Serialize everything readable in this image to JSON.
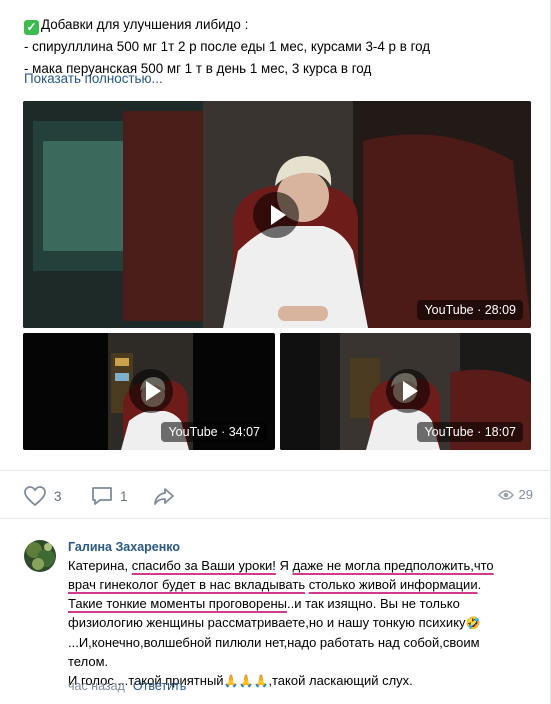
{
  "post": {
    "line1": "Добавки для улучшения либидо :",
    "line2": "- спирулллина 500 мг 1т 2 р после еды 1 мес, курсами 3-4 р в год",
    "line3": "- мака перуанская 500 мг 1 т в день 1 мес, 3 курса в год",
    "show_more": "Показать полностью..."
  },
  "videos": [
    {
      "source": "YouTube",
      "duration": "28:09",
      "badge": "YouTube · 28:09"
    },
    {
      "source": "YouTube",
      "duration": "34:07",
      "badge": "YouTube · 34:07"
    },
    {
      "source": "YouTube",
      "duration": "18:07",
      "badge": "YouTube · 18:07"
    }
  ],
  "actions": {
    "likes": "3",
    "comments": "1",
    "views": "29"
  },
  "comment": {
    "author": "Галина Захаренко",
    "lines": [
      {
        "a": "Катерина, ",
        "u1": "спасибо за Ваши уроки!",
        "b": " Я ",
        "u2": "даже не могла предположить,что"
      },
      {
        "u1": "врач гинеколог будет в нас вкладывать",
        "b": " ",
        "u2": "столько живой информации",
        "c": "."
      },
      {
        "u1": "Такие тонкие моменты проговорены",
        "b": "..и так изящно. Вы не только"
      },
      {
        "a": "физиологию женщины рассматриваете,но и нашу тонкую психику",
        "emoji": "🤣"
      },
      {
        "a": "...И,конечно,волшебной пилюли нет,надо работать над собой,своим"
      },
      {
        "a": "телом."
      },
      {
        "a": "И голос....такой приятный",
        "emoji": "🙏🙏🙏",
        "b": ",такой ласкающий слух."
      }
    ],
    "time": "час назад",
    "reply": "Ответить"
  },
  "colors": {
    "link": "#2a5885",
    "underline": "#d23a8c",
    "muted": "#818c99",
    "check": "#3dbb4f"
  }
}
